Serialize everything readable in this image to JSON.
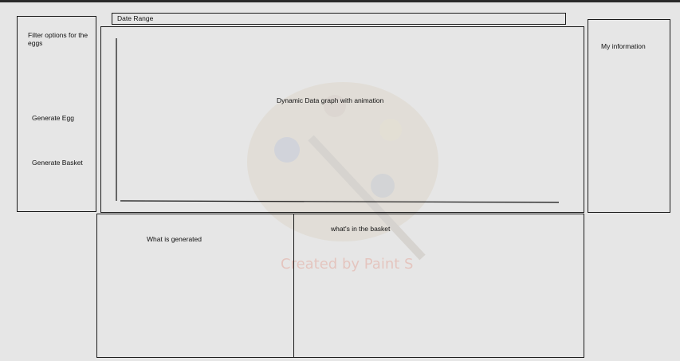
{
  "header": {
    "date_range_label": "Date Range"
  },
  "sidebar": {
    "filter_label": "Filter options for the eggs",
    "generate_egg_label": "Generate Egg",
    "generate_basket_label": "Generate Basket"
  },
  "graph": {
    "label": "Dynamic Data graph with animation"
  },
  "info": {
    "label": "My information"
  },
  "bottom": {
    "generated_label": "What is generated",
    "basket_label": "what's in the basket"
  },
  "watermark": {
    "text": "Created by Paint S"
  }
}
